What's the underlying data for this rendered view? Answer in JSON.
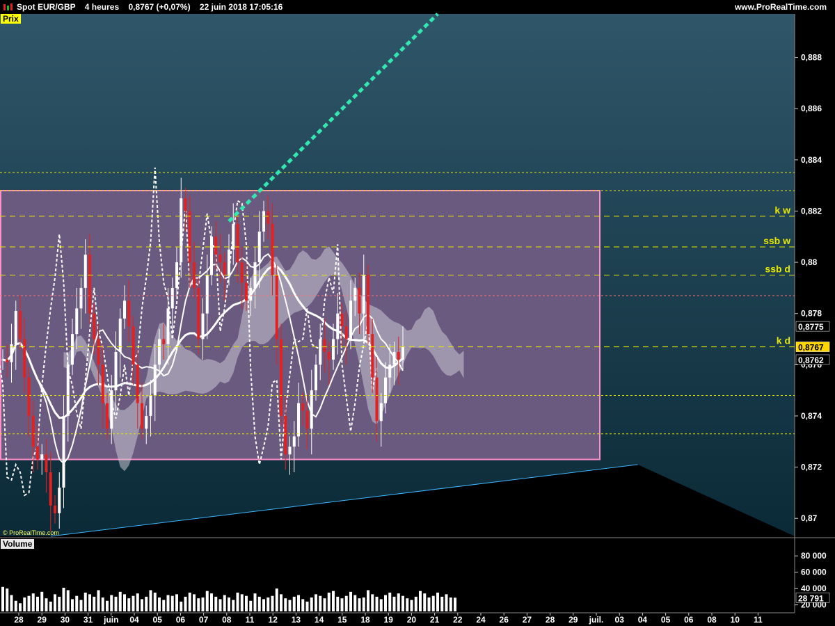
{
  "header": {
    "instrument": "Spot EUR/GBP",
    "timeframe": "4 heures",
    "last_price": "0,8767",
    "change": "(+0,07%)",
    "datetime": "22 juin 2018 17:05:16",
    "site": "www.ProRealTime.com",
    "icon": "bar-chart-icon"
  },
  "panels": {
    "price_label": "Prix",
    "volume_label": "Volume",
    "copyright": "© ProRealTime.com"
  },
  "colors": {
    "bg_top": "#2f5669",
    "bg_bottom": "#0b2a37",
    "range_box_fill": "#6a5a80",
    "range_box_stroke": "#ff8fc8",
    "trendline_up": "#33e8b0",
    "trendline_down": "#3fb6ff",
    "candle_up": "#ffffff",
    "candle_down": "#e52020",
    "level_line": "#e8e800",
    "kumo": "#c8c8d0"
  },
  "chart_data": [
    {
      "type": "candlestick",
      "pair": "EUR/GBP",
      "ylim": [
        0.8693,
        0.8897
      ],
      "y_ticks": [
        "0,87",
        "0,872",
        "0,874",
        "0,876",
        "0,878",
        "0,88",
        "0,882",
        "0,884",
        "0,886",
        "0,888"
      ],
      "y_tick_values": [
        0.87,
        0.872,
        0.874,
        0.876,
        0.878,
        0.88,
        0.882,
        0.884,
        0.886,
        0.888
      ],
      "x_ticks": [
        "28",
        "29",
        "30",
        "31",
        "juin",
        "04",
        "05",
        "06",
        "07",
        "08",
        "11",
        "12",
        "13",
        "14",
        "15",
        "18",
        "19",
        "20",
        "21",
        "22",
        "24",
        "26",
        "27",
        "28",
        "29",
        "juil.",
        "03",
        "04",
        "05",
        "06",
        "08",
        "10",
        "11"
      ],
      "closes": [
        0.8762,
        0.8761,
        0.8768,
        0.8781,
        0.877,
        0.8755,
        0.874,
        0.8728,
        0.8723,
        0.8725,
        0.8718,
        0.8705,
        0.8702,
        0.8712,
        0.874,
        0.876,
        0.8772,
        0.8782,
        0.879,
        0.8803,
        0.878,
        0.877,
        0.876,
        0.8745,
        0.8735,
        0.875,
        0.8765,
        0.8778,
        0.8785,
        0.8775,
        0.876,
        0.8745,
        0.8735,
        0.874,
        0.8748,
        0.876,
        0.877,
        0.8768,
        0.8782,
        0.879,
        0.88,
        0.8825,
        0.882,
        0.88,
        0.879,
        0.877,
        0.878,
        0.8795,
        0.881,
        0.8803,
        0.88,
        0.8795,
        0.8805,
        0.8815,
        0.88,
        0.8792,
        0.8785,
        0.879,
        0.88,
        0.8812,
        0.882,
        0.8815,
        0.8795,
        0.877,
        0.874,
        0.8725,
        0.8728,
        0.8732,
        0.8745,
        0.8742,
        0.8735,
        0.875,
        0.876,
        0.877,
        0.8765,
        0.8762,
        0.877,
        0.878,
        0.8775,
        0.877,
        0.8785,
        0.879,
        0.878,
        0.8795,
        0.8772,
        0.8755,
        0.8738,
        0.8745,
        0.8755,
        0.876,
        0.8765,
        0.8762,
        0.8767
      ],
      "levels": [
        {
          "value": 0.8835,
          "label": "",
          "style": "dotted"
        },
        {
          "value": 0.8828,
          "label": "",
          "style": "dotted"
        },
        {
          "value": 0.8818,
          "label": "k w",
          "style": "dashed"
        },
        {
          "value": 0.8806,
          "label": "ssb w",
          "style": "dashed"
        },
        {
          "value": 0.8795,
          "label": "ssb d",
          "style": "dashed"
        },
        {
          "value": 0.8787,
          "label": "",
          "style": "dotted-red"
        },
        {
          "value": 0.8767,
          "label": "k d",
          "style": "dashed"
        },
        {
          "value": 0.8748,
          "label": "",
          "style": "dotted"
        },
        {
          "value": 0.8733,
          "label": "",
          "style": "dotted"
        }
      ],
      "price_badges": [
        {
          "value": 0.8775,
          "text": "0,8775",
          "highlight": false
        },
        {
          "value": 0.8767,
          "text": "0,8767",
          "highlight": true
        },
        {
          "value": 0.8762,
          "text": "0,8762",
          "highlight": false
        }
      ],
      "range_box": {
        "high": 0.8828,
        "low": 0.8723,
        "start_index": 0,
        "end_index": 108
      },
      "trend_up": {
        "from": [
          52,
          0.8816
        ],
        "to": [
          100,
          0.8897
        ]
      },
      "trend_down": {
        "from": [
          11,
          0.8693
        ],
        "to": [
          146,
          0.8721
        ]
      }
    },
    {
      "type": "bar",
      "series_name": "Volume",
      "ylim": [
        12000,
        87000
      ],
      "y_ticks": [
        "80 000",
        "60 000",
        "40 000",
        "20 000"
      ],
      "y_tick_values": [
        80000,
        60000,
        40000,
        20000
      ],
      "last_value_label": "28 791",
      "last_value": 28791,
      "values": [
        42000,
        40000,
        32000,
        25000,
        22000,
        29000,
        31000,
        34000,
        30000,
        36000,
        28000,
        24000,
        33000,
        30000,
        41000,
        38000,
        27000,
        31000,
        26000,
        35000,
        33000,
        30000,
        38000,
        29000,
        25000,
        32000,
        30000,
        36000,
        33000,
        28000,
        31000,
        34000,
        27000,
        30000,
        38000,
        35000,
        29000,
        26000,
        32000,
        31000,
        33000,
        24000,
        30000,
        35000,
        33000,
        28000,
        29000,
        37000,
        34000,
        30000,
        27000,
        32000,
        29000,
        26000,
        35000,
        33000,
        31000,
        25000,
        34000,
        30000,
        27000,
        29000,
        31000,
        40000,
        33000,
        28000,
        26000,
        30000,
        32000,
        27000,
        24000,
        29000,
        33000,
        31000,
        28000,
        35000,
        37000,
        30000,
        28000,
        31000,
        36000,
        32000,
        28000,
        29000,
        38000,
        33000,
        30000,
        27000,
        32000,
        35000,
        30000,
        34000,
        31000,
        28000,
        26000,
        30000,
        37000,
        34000,
        29000,
        31000,
        35000,
        30000,
        33000,
        29000,
        28791
      ]
    }
  ]
}
